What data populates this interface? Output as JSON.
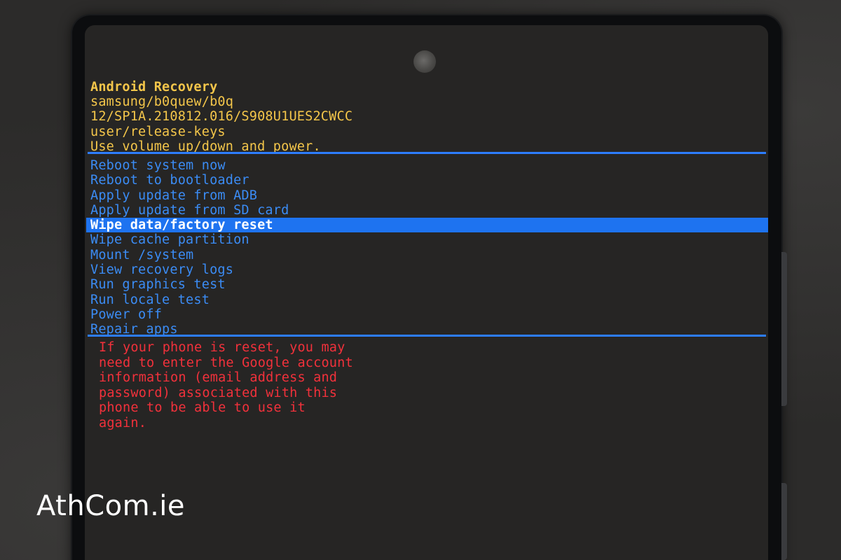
{
  "recovery": {
    "header": {
      "title": "Android Recovery",
      "lines": [
        "samsung/b0quew/b0q",
        "12/SP1A.210812.016/S908U1UES2CWCC",
        "user/release-keys",
        "Use volume up/down and power."
      ]
    },
    "menu": {
      "items": [
        "Reboot system now",
        "Reboot to bootloader",
        "Apply update from ADB",
        "Apply update from SD card",
        "Wipe data/factory reset",
        "Wipe cache partition",
        "Mount /system",
        "View recovery logs",
        "Run graphics test",
        "Run locale test",
        "Power off",
        "Repair apps"
      ],
      "selected": "Wipe data/factory reset"
    },
    "warning": {
      "lines": [
        "If your phone is reset, you may",
        "need to enter the Google account",
        "information (email address and",
        "password) associated with this",
        "phone to be able to use it",
        "again."
      ]
    }
  },
  "watermark": "AthCom.ie",
  "colors": {
    "header_text": "#f4c64a",
    "menu_text": "#3b8cf5",
    "selection_bar": "#1e73f0",
    "warning_text": "#f2313b",
    "screen_background": "#262524"
  }
}
